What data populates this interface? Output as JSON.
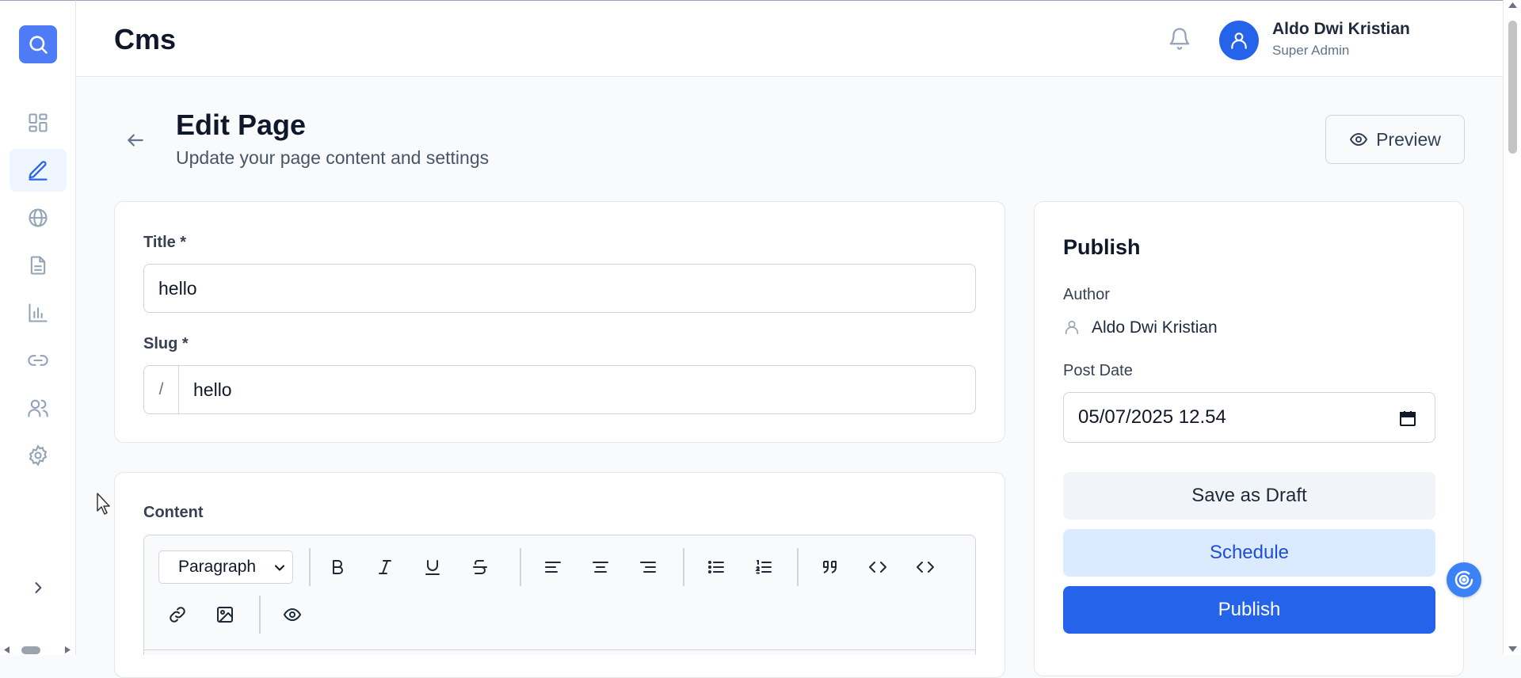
{
  "header": {
    "app_title": "Cms",
    "user_name": "Aldo Dwi Kristian",
    "user_role": "Super Admin"
  },
  "sidebar": {
    "items": [
      {
        "name": "dashboard",
        "icon": "grid-icon",
        "active": false
      },
      {
        "name": "pages",
        "icon": "pencil-icon",
        "active": true
      },
      {
        "name": "web",
        "icon": "globe-icon",
        "active": false
      },
      {
        "name": "documents",
        "icon": "document-icon",
        "active": false
      },
      {
        "name": "analytics",
        "icon": "bar-chart-icon",
        "active": false
      },
      {
        "name": "links",
        "icon": "link-icon",
        "active": false
      },
      {
        "name": "users",
        "icon": "users-icon",
        "active": false
      },
      {
        "name": "settings",
        "icon": "gear-icon",
        "active": false
      }
    ]
  },
  "page": {
    "title": "Edit Page",
    "subtitle": "Update your page content and settings",
    "preview_label": "Preview"
  },
  "form": {
    "title_label": "Title *",
    "title_value": "hello",
    "slug_label": "Slug *",
    "slug_prefix": "/",
    "slug_value": "hello",
    "content_label": "Content",
    "block_format": "Paragraph"
  },
  "publish": {
    "heading": "Publish",
    "author_label": "Author",
    "author_name": "Aldo Dwi Kristian",
    "post_date_label": "Post Date",
    "post_date_value": "05/07/2025 12.54",
    "save_draft_label": "Save as Draft",
    "schedule_label": "Schedule",
    "publish_label": "Publish"
  },
  "colors": {
    "primary": "#2563eb",
    "logo": "#4f7bf7",
    "schedule_bg": "#dbeafe"
  }
}
